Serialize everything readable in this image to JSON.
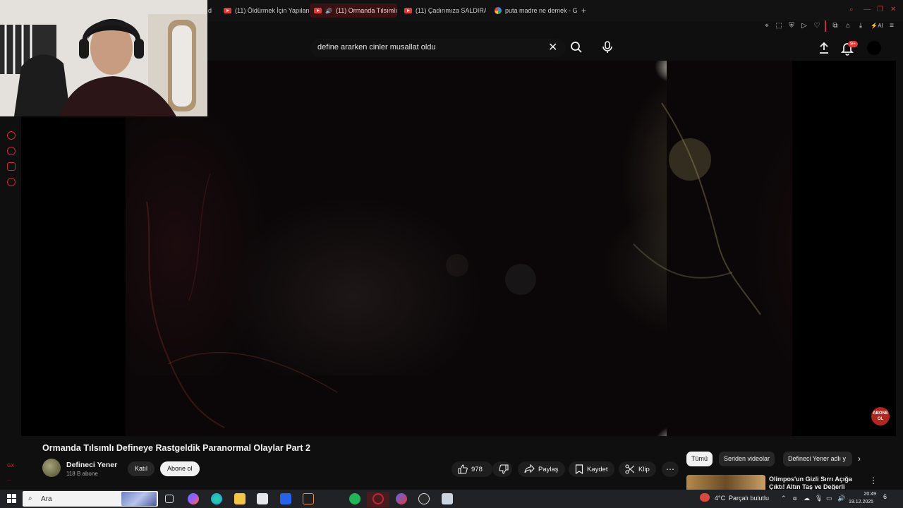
{
  "browser": {
    "tabs": [
      {
        "label": "d",
        "favicon": "none"
      },
      {
        "label": "(11) Öldürmek İçin Yapılan",
        "favicon": "youtube-icon"
      },
      {
        "label": "(11) Ormanda Tılsımlı D",
        "favicon": "youtube-icon",
        "active": true,
        "muted_icon": "speaker-icon"
      },
      {
        "label": "(11) Çadırımıza SALDIRAN",
        "favicon": "youtube-icon"
      },
      {
        "label": "puta madre ne demek - Go",
        "favicon": "google-icon"
      }
    ],
    "accent": "#e53935"
  },
  "search": {
    "query": "define ararken cinler musallat oldu"
  },
  "header": {
    "notification_badge": "9+"
  },
  "sidebar": {
    "icons": [
      "play-icon",
      "clock-icon",
      "like-icon",
      "settings-icon"
    ],
    "bottom_labels": [
      "GX",
      "..."
    ]
  },
  "video": {
    "title": "Ormanda Tılsımlı Defineye Rastgeldik Paranormal Olaylar Part 2",
    "channel_name": "Defineci Yener",
    "subscribers": "118 B abone",
    "join_label": "Katıl",
    "subscribe_label": "Abone ol",
    "like_count": "978",
    "share_label": "Paylaş",
    "save_label": "Kaydet",
    "clip_label": "Klip",
    "watermark_label": "ABONE OL"
  },
  "chips": {
    "all": "Tümü",
    "series": "Seriden videolar",
    "channel": "Defineci Yener adlı y"
  },
  "recommendation": {
    "title": "Olimpos'un Gizli Sırrı Açığa Çıktı! Altın Taş ve Değerli"
  },
  "taskbar": {
    "search_text": "Ara",
    "temperature": "4°C",
    "weather": "Parçalı bulutlu",
    "time": "20:49",
    "date": "19.12.2025",
    "notification_count": "6"
  }
}
